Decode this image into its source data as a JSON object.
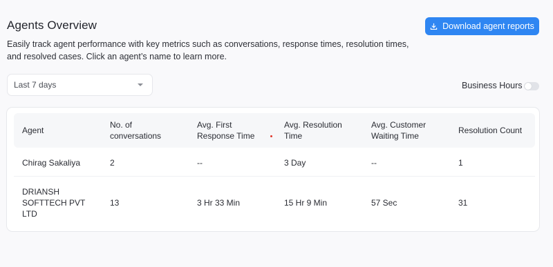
{
  "header": {
    "title": "Agents Overview",
    "description": "Easily track agent performance with key metrics such as conversations, response times, resolution times, and resolved cases. Click an agent’s name to learn more.",
    "download_label": "Download agent reports"
  },
  "filters": {
    "range_value": "Last 7 days",
    "business_hours_label": "Business Hours",
    "business_hours_enabled": false
  },
  "table": {
    "columns": [
      "Agent",
      "No. of conversations",
      "Avg. First Response Time",
      "Avg. Resolution Time",
      "Avg. Customer Waiting Time",
      "Resolution Count"
    ],
    "rows": [
      [
        "Chirag Sakaliya",
        "2",
        "--",
        "3 Day",
        "--",
        "1"
      ],
      [
        "DRIANSH SOFTTECH PVT LTD",
        "13",
        "3 Hr 33 Min",
        "15 Hr 9 Min",
        "57 Sec",
        "31"
      ]
    ]
  },
  "colors": {
    "accent": "#2f86f2",
    "background": "#f9f9fb"
  },
  "icons": {
    "download": "download-icon",
    "dropdown": "chevron-down-icon"
  }
}
